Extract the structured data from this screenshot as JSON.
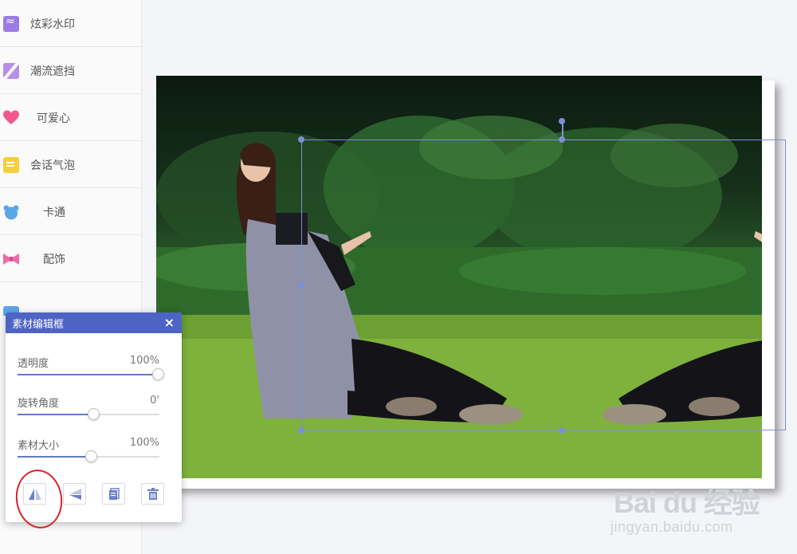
{
  "sidebar": {
    "items": [
      {
        "label": "炫彩水印",
        "icon": "wave-icon",
        "color": "#9c7be6"
      },
      {
        "label": "潮流遮挡",
        "icon": "slash-icon",
        "color": "#b98ee8"
      },
      {
        "label": "可爱心",
        "icon": "heart-icon",
        "color": "#f05a8a"
      },
      {
        "label": "会话气泡",
        "icon": "speech-bubble-icon",
        "color": "#f5cf3c"
      },
      {
        "label": "卡通",
        "icon": "bear-icon",
        "color": "#5aa7e8"
      },
      {
        "label": "配饰",
        "icon": "bow-icon",
        "color": "#f06aa8"
      }
    ]
  },
  "editor_panel": {
    "title": "素材编辑框",
    "close": "×",
    "sliders": [
      {
        "label": "透明度",
        "value": "100%",
        "fraction": 1.0
      },
      {
        "label": "旋转角度",
        "value": "0'",
        "fraction": 0.5
      },
      {
        "label": "素材大小",
        "value": "100%",
        "fraction": 0.48
      }
    ],
    "tools": [
      {
        "name": "flip-horizontal",
        "icon": "flip-horizontal-icon"
      },
      {
        "name": "flip-vertical",
        "icon": "flip-vertical-icon"
      },
      {
        "name": "copy",
        "icon": "copy-icon"
      },
      {
        "name": "delete",
        "icon": "trash-icon"
      }
    ]
  },
  "watermark": {
    "main": "Bai du 经验",
    "sub": "jingyan.baidu.com"
  },
  "colors": {
    "accent": "#4e64c4",
    "selection": "#7d8fd6",
    "annotation": "#d8232a"
  }
}
